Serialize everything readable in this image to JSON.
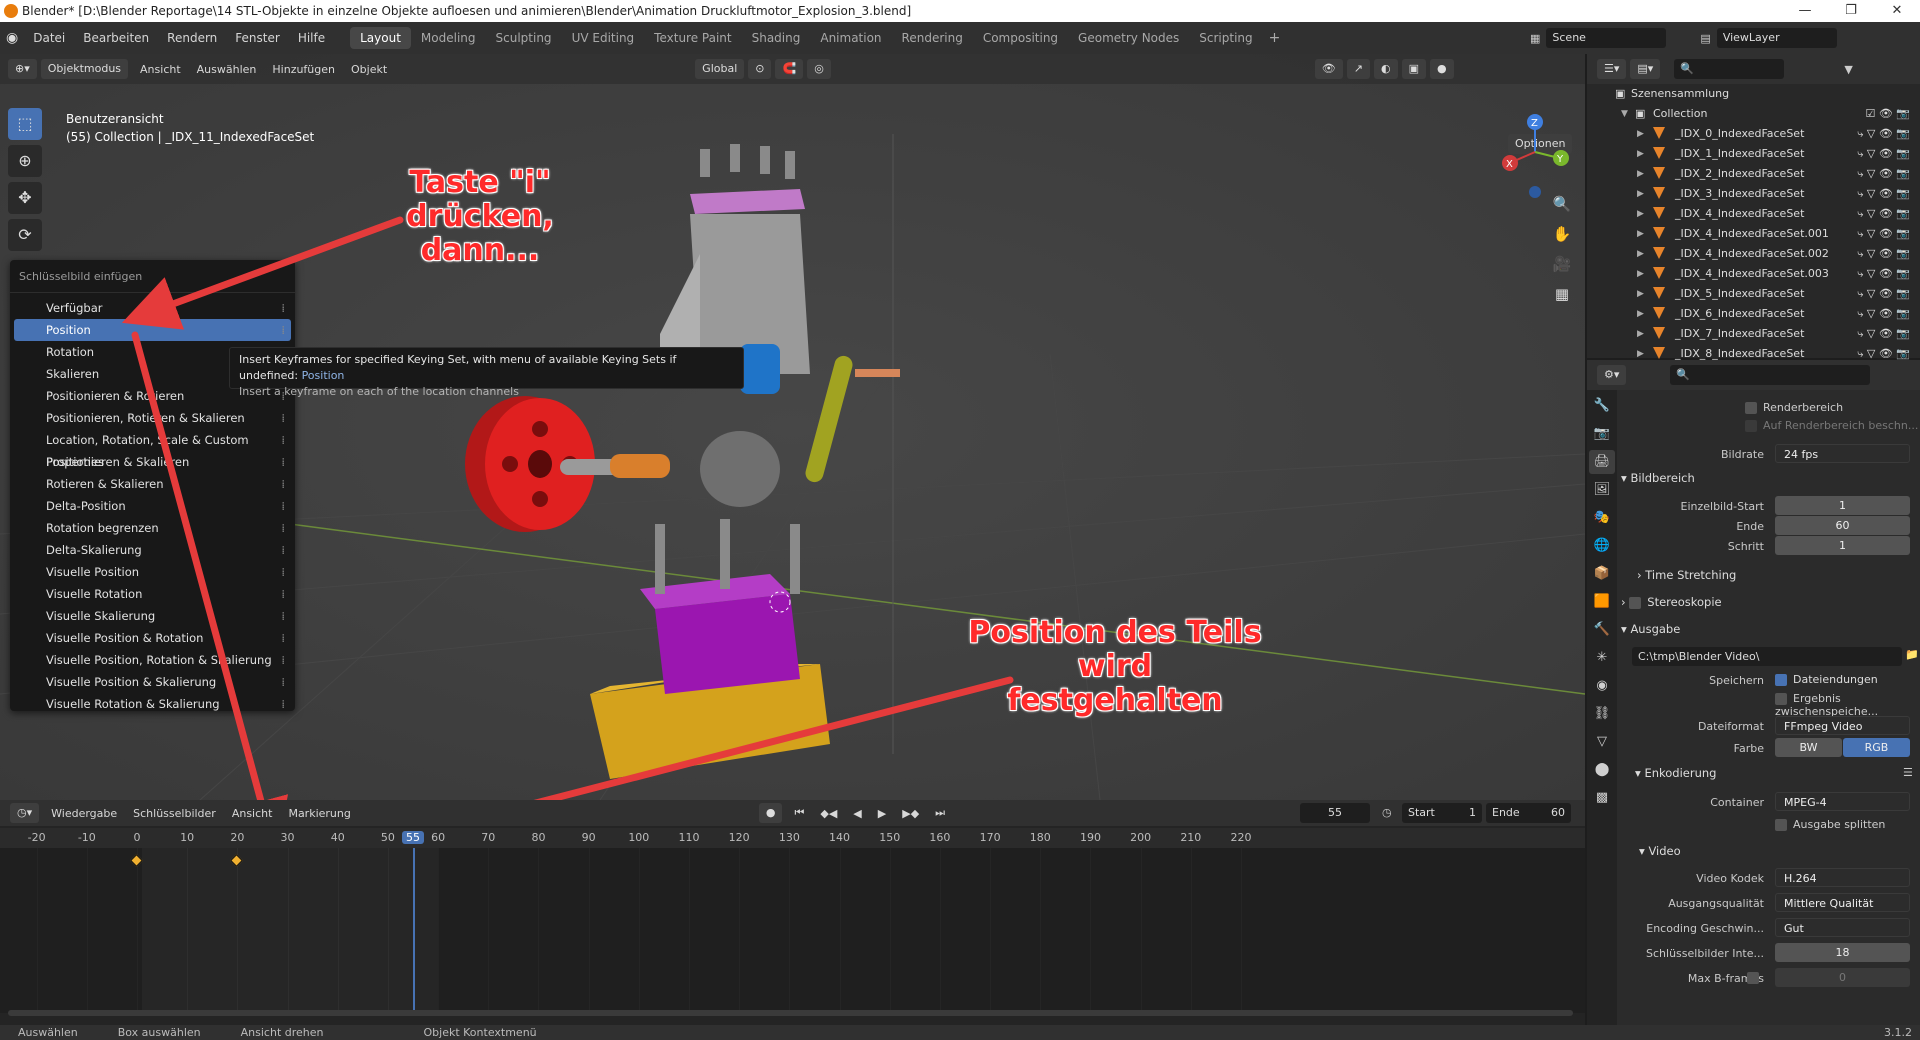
{
  "title": "Blender* [D:\\Blender Reportage\\14 STL-Objekte in einzelne Objekte aufloesen und animieren\\Blender\\Animation Druckluftmotor_Explosion_3.blend]",
  "menus": [
    "Datei",
    "Bearbeiten",
    "Rendern",
    "Fenster",
    "Hilfe"
  ],
  "workspaces": [
    "Layout",
    "Modeling",
    "Sculpting",
    "UV Editing",
    "Texture Paint",
    "Shading",
    "Animation",
    "Rendering",
    "Compositing",
    "Geometry Nodes",
    "Scripting"
  ],
  "scene_label": "Scene",
  "viewlayer_label": "ViewLayer",
  "viewport": {
    "mode": "Objektmodus",
    "menu": [
      "Ansicht",
      "Auswählen",
      "Hinzufügen",
      "Objekt"
    ],
    "transform": "Global",
    "options": "Optionen",
    "info_line1": "Benutzeransicht",
    "info_line2": "(55) Collection | _IDX_11_IndexedFaceSet"
  },
  "context_menu": {
    "title": "Schlüsselbild einfügen",
    "items": [
      "Verfügbar",
      "Position",
      "Rotation",
      "Skalieren",
      "Positionieren & Rotieren",
      "Positionieren, Rotieren & Skalieren",
      "Location, Rotation, Scale & Custom Properties",
      "Positionieren & Skalieren",
      "Rotieren & Skalieren",
      "Delta-Position",
      "Rotation begrenzen",
      "Delta-Skalierung",
      "Visuelle Position",
      "Visuelle Rotation",
      "Visuelle Skalierung",
      "Visuelle Position & Rotation",
      "Visuelle Position, Rotation & Skalierung",
      "Visuelle Position & Skalierung",
      "Visuelle Rotation & Skalierung"
    ],
    "highlighted": "Position"
  },
  "tooltip": {
    "line1": "Insert Keyframes for specified Keying Set, with menu of available Keying Sets if undefined:",
    "keyword": "Position",
    "line2": "Insert a keyframe on each of the location channels"
  },
  "annotations": {
    "top_line1": "Taste \"i\" drücken,",
    "top_line2": "dann...",
    "bottom_line1": "Position des Teils wird",
    "bottom_line2": "festgehalten"
  },
  "timeline": {
    "menus": [
      "Wiedergabe",
      "Schlüsselbilder",
      "Ansicht",
      "Markierung"
    ],
    "current_frame": "55",
    "start_label": "Start",
    "start": "1",
    "end_label": "Ende",
    "end": "60",
    "ticks": [
      "-20",
      "-10",
      "0",
      "10",
      "20",
      "30",
      "40",
      "50",
      "55",
      "60",
      "70",
      "80",
      "90",
      "100",
      "110",
      "120",
      "130",
      "140",
      "150",
      "160",
      "170",
      "180",
      "190",
      "200",
      "210",
      "220"
    ],
    "keyframes": [
      0,
      20
    ]
  },
  "status": [
    "Auswählen",
    "Box auswählen",
    "Ansicht drehen",
    "Objekt Kontextmenü"
  ],
  "version": "3.1.2",
  "outliner": {
    "root": "Szenensammlung",
    "collection": "Collection",
    "items": [
      "_IDX_0_IndexedFaceSet",
      "_IDX_1_IndexedFaceSet",
      "_IDX_2_IndexedFaceSet",
      "_IDX_3_IndexedFaceSet",
      "_IDX_4_IndexedFaceSet",
      "_IDX_4_IndexedFaceSet.001",
      "_IDX_4_IndexedFaceSet.002",
      "_IDX_4_IndexedFaceSet.003",
      "_IDX_5_IndexedFaceSet",
      "_IDX_6_IndexedFaceSet",
      "_IDX_7_IndexedFaceSet",
      "_IDX_8_IndexedFaceSet"
    ]
  },
  "properties": {
    "renderbereich": "Renderbereich",
    "auf_renderbereich": "Auf Renderbereich beschn...",
    "bildrate_label": "Bildrate",
    "bildrate": "24 fps",
    "bildbereich": "Bildbereich",
    "einzelbild_start_label": "Einzelbild-Start",
    "einzelbild_start": "1",
    "ende_label": "Ende",
    "ende": "60",
    "schritt_label": "Schritt",
    "schritt": "1",
    "time_stretching": "Time Stretching",
    "stereoskopie": "Stereoskopie",
    "ausgabe": "Ausgabe",
    "path": "C:\\tmp\\Blender Video\\",
    "speichern_label": "Speichern",
    "dateiendungen": "Dateiendungen",
    "ergebnis": "Ergebnis zwischenspeiche...",
    "dateiformat_label": "Dateiformat",
    "dateiformat": "FFmpeg Video",
    "farbe_label": "Farbe",
    "farbe_bw": "BW",
    "farbe_rgb": "RGB",
    "enkodierung": "Enkodierung",
    "container_label": "Container",
    "container": "MPEG-4",
    "ausgabe_splitten": "Ausgabe splitten",
    "video": "Video",
    "kodek_label": "Video Kodek",
    "kodek": "H.264",
    "qualitaet_label": "Ausgangsqualität",
    "qualitaet": "Mittlere Qualität",
    "geschwindigkeit_label": "Encoding Geschwin...",
    "geschwindigkeit": "Gut",
    "keyint_label": "Schlüsselbilder Inte...",
    "keyint": "18",
    "bframes_label": "Max B-frames",
    "bframes": "0"
  },
  "colors": {
    "accent": "#4772b3",
    "annotation": "#ff2a2a",
    "keyframe": "#f0b030",
    "playhead": "#4772b3"
  }
}
